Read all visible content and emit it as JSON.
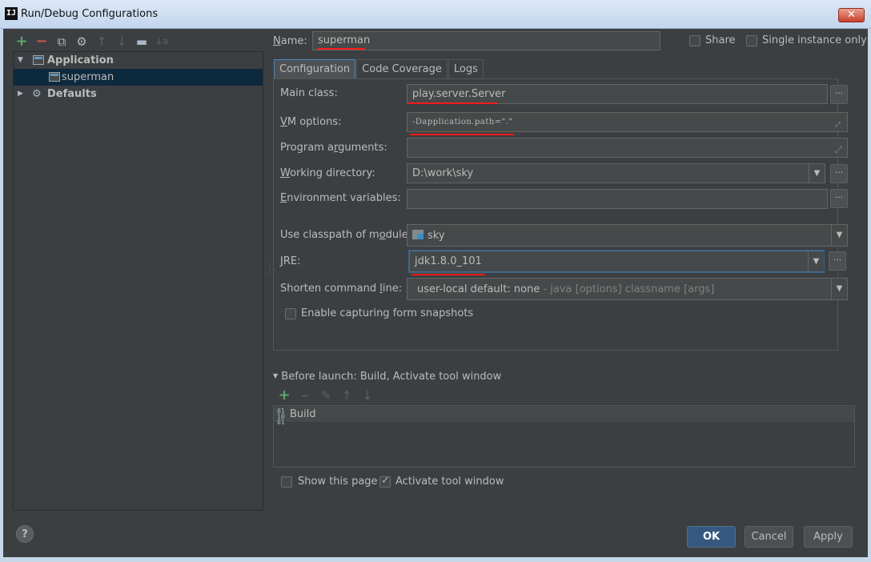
{
  "window": {
    "app_icon_text": "IJ",
    "title": "Run/Debug Configurations",
    "close_label": "✕"
  },
  "toolbar": {
    "add": "+",
    "remove": "−",
    "copy": "⧉",
    "settings": "⚙",
    "up": "↑",
    "down": "↓",
    "folder": "▬",
    "sort": "↓a"
  },
  "tree": {
    "application": "Application",
    "superman": "superman",
    "defaults": "Defaults"
  },
  "header": {
    "name_label_pre": "",
    "name_label_key": "N",
    "name_label_post": "ame:",
    "name_value": "superman",
    "share_label": "Share",
    "single_instance_label": "Single instance only"
  },
  "tabs": [
    "Configuration",
    "Code Coverage",
    "Logs"
  ],
  "form": {
    "main_class_label": "Main class:",
    "main_class_value": "play.server.Server",
    "vm_options_label": "VM options:",
    "vm_options_value": "-Dapplication.path=\".\"",
    "program_args_label": "Program arguments:",
    "program_args_value": "",
    "working_dir_label": "Working directory:",
    "working_dir_value": "D:\\work\\sky",
    "env_vars_label": "Environment variables:",
    "env_vars_value": "",
    "classpath_label": "Use classpath of module:",
    "classpath_value": "sky",
    "jre_label": "JRE:",
    "jre_value": "jdk1.8.0_101",
    "shorten_label": "Shorten command line:",
    "shorten_value": "user-local default: none",
    "shorten_hint": " - java [options] classname [args]",
    "snapshots_label": "Enable capturing form snapshots"
  },
  "before_launch": {
    "title": "Before launch: Build, Activate tool window",
    "items": [
      "Build"
    ],
    "show_page_label": "Show this page",
    "activate_label": "Activate tool window"
  },
  "buttons": {
    "help": "?",
    "ok": "OK",
    "cancel": "Cancel",
    "apply": "Apply"
  },
  "colors": {
    "background": "#3c3f41",
    "selection": "#0d293e",
    "primary_button": "#365880",
    "annotation_red": "#ff1a1a"
  }
}
